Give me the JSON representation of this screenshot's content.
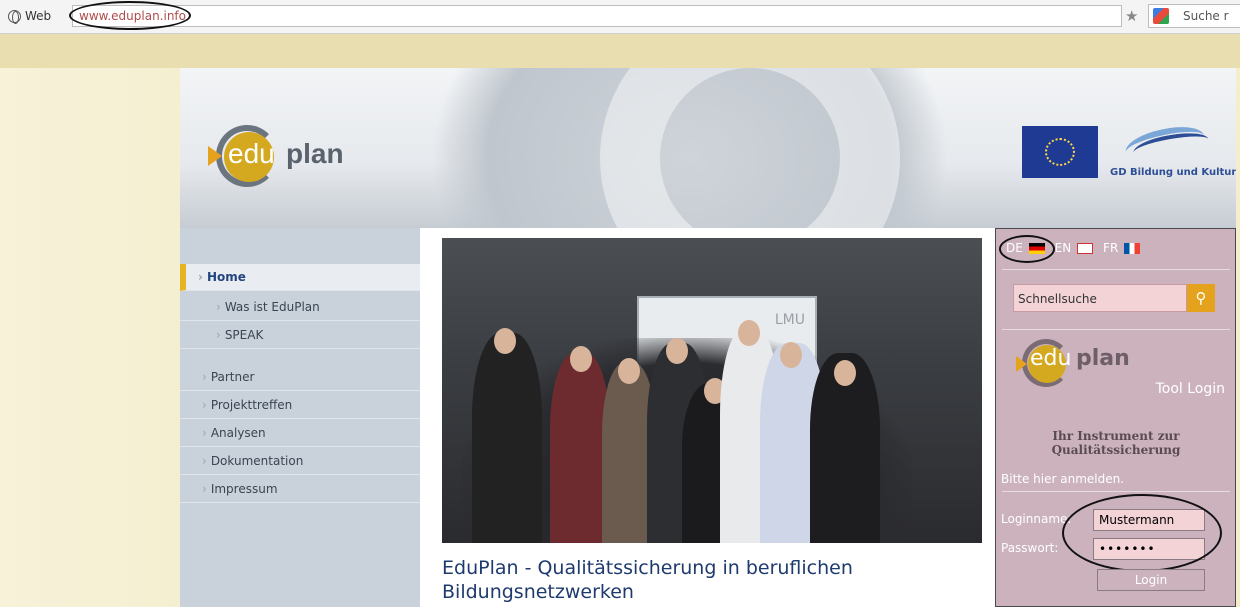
{
  "browser": {
    "web_label": "Web",
    "url": "www.eduplan.info",
    "search_placeholder": "Suche r"
  },
  "header": {
    "logo_text_a": "edu",
    "logo_text_b": "plan",
    "partner_caption": "GD Bildung und Kultur"
  },
  "nav": {
    "items": [
      {
        "label": "Home"
      },
      {
        "label": "Was ist EduPlan"
      },
      {
        "label": "SPEAK"
      },
      {
        "label": "Partner"
      },
      {
        "label": "Projekttreffen"
      },
      {
        "label": "Analysen"
      },
      {
        "label": "Dokumentation"
      },
      {
        "label": "Impressum"
      }
    ]
  },
  "main": {
    "photo_board_text_a": "LMU",
    "title": "EduPlan - Qualitätssicherung in beruflichen Bildungsnetzwerken"
  },
  "panel": {
    "langs": [
      "DE",
      "EN",
      "FR"
    ],
    "quicksearch_placeholder": "Schnellsuche",
    "tool_login": "Tool Login",
    "instrument_text": "Ihr Instrument zur Qualitätssicherung",
    "hint": "Bitte hier anmelden.",
    "login_label": "Loginname:",
    "login_value": "Mustermann",
    "password_label": "Passwort:",
    "password_value": "•••••••",
    "login_button": "Login"
  },
  "colors": {
    "accent": "#e5a21c",
    "nav_bg": "#c9d2da",
    "panel_bg": "#cbb2bd",
    "title": "#1f3a6e"
  }
}
